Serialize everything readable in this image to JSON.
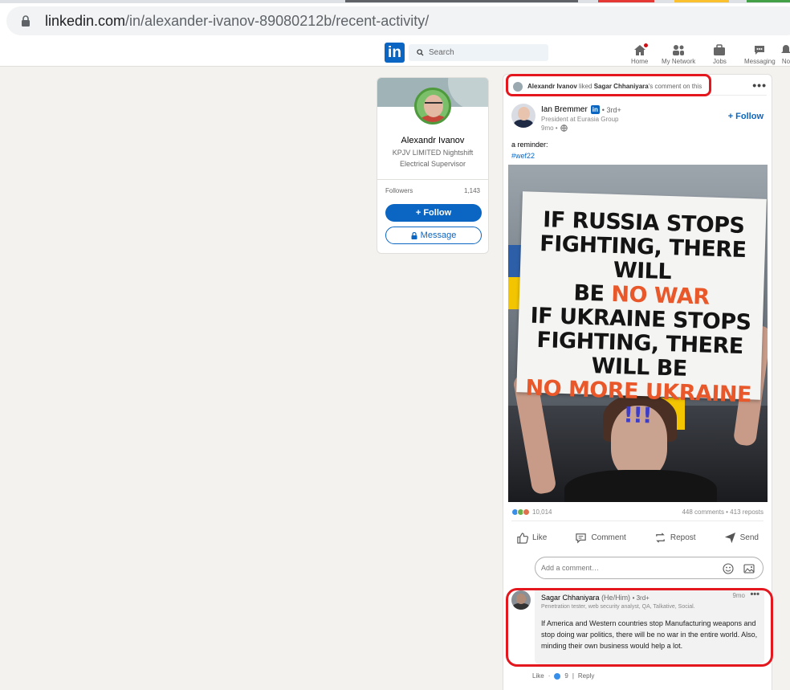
{
  "browser": {
    "url_domain": "linkedin.com",
    "url_path": "/in/alexander-ivanov-89080212b/recent-activity/"
  },
  "nav": {
    "logo": "in",
    "search_placeholder": "Search",
    "items": [
      {
        "label": "Home",
        "icon": "home-icon"
      },
      {
        "label": "My Network",
        "icon": "network-icon"
      },
      {
        "label": "Jobs",
        "icon": "briefcase-icon"
      },
      {
        "label": "Messaging",
        "icon": "messaging-icon"
      },
      {
        "label": "No",
        "icon": "bell-icon"
      }
    ]
  },
  "profile": {
    "name": "Alexandr Ivanov",
    "headline": "KPJV LIMITED Nightshift Electrical Supervisor",
    "followers_label": "Followers",
    "followers_count": "1,143",
    "follow_label": "+ Follow",
    "message_label": "Message"
  },
  "activity": {
    "actor": "Alexandr Ivanov",
    "verb": " liked ",
    "target": "Sagar Chhaniyara",
    "suffix": "'s comment on this"
  },
  "post": {
    "author_name": "Ian Bremmer",
    "author_badge": "in",
    "author_degree": "• 3rd+",
    "author_headline": "President at Eurasia Group",
    "time": "9mo •",
    "follow_label": "+ Follow",
    "text": "a reminder:",
    "hashtag": "#wef22",
    "placard": {
      "line1": "IF RUSSIA STOPS",
      "line2": "FIGHTING, THERE WILL",
      "line3a": "BE ",
      "line3b": "NO WAR",
      "line4": "IF UKRAINE STOPS",
      "line5": "FIGHTING, THERE WILL BE",
      "line6": "NO MORE UKRAINE",
      "line7": "!!!"
    },
    "reaction_count": "10,014",
    "comments_reposts": "448 comments • 413 reposts",
    "actions": [
      "Like",
      "Comment",
      "Repost",
      "Send"
    ],
    "comment_placeholder": "Add a comment…"
  },
  "comment": {
    "name": "Sagar Chhaniyara",
    "pronouns": "(He/Him)",
    "degree": "• 3rd+",
    "time": "9mo",
    "headline": "Penetration tester, web security analyst, QA, Talkative, Social.",
    "text": "If America and Western countries stop Manufacturing weapons and stop doing war politics, there will be no war in the entire world. Also, minding their own business would help a lot.",
    "like_label": "Like",
    "like_count": "9",
    "reply_label": "Reply"
  },
  "colors": {
    "linkedin_blue": "#0a66c2",
    "highlight_red": "#e3171d",
    "placard_orange": "#e8582a"
  }
}
